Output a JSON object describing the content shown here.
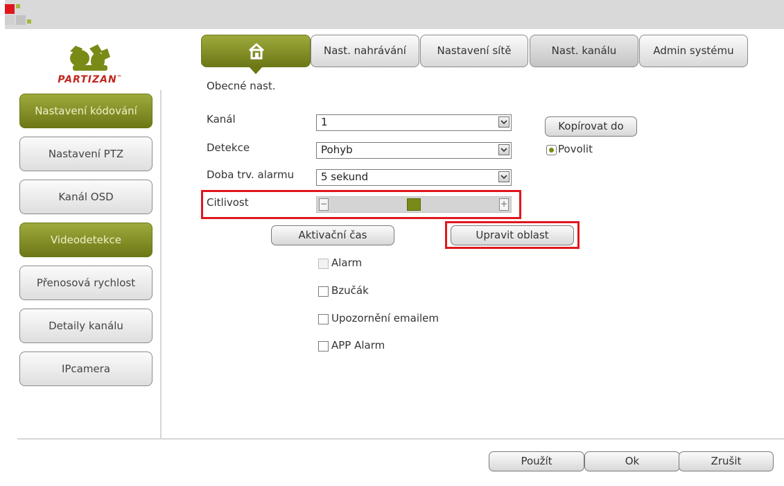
{
  "tabs": {
    "home_icon": "house-icon",
    "recording": "Nast. nahrávání",
    "network": "Nastavení sítě",
    "channel": "Nast. kanálu",
    "admin": "Admin systému"
  },
  "subtitle": "Obecné nast.",
  "logo": {
    "text": "PARTIZAN",
    "tm": "™"
  },
  "sidebar": {
    "items": [
      {
        "label": "Nastavení kódování",
        "active": true
      },
      {
        "label": "Nastavení PTZ",
        "active": false
      },
      {
        "label": "Kanál OSD",
        "active": false
      },
      {
        "label": "Videodetekce",
        "active": true
      },
      {
        "label": "Přenosová rychlost",
        "active": false
      },
      {
        "label": "Detaily kanálu",
        "active": false
      },
      {
        "label": "IPcamera",
        "active": false
      }
    ]
  },
  "form": {
    "channel_label": "Kanál",
    "channel_value": "1",
    "detection_label": "Detekce",
    "detection_value": "Pohyb",
    "alarm_duration_label": "Doba trv. alarmu",
    "alarm_duration_value": "5 sekund",
    "sensitivity_label": "Citlivost",
    "sensitivity_value": 0.5,
    "sensitivity_minus": "−",
    "sensitivity_plus": "+",
    "copy_button": "Kopírovat do",
    "enable_label": "Povolit",
    "enable_checked": true,
    "activation_time_button": "Aktivační čas",
    "edit_area_button": "Upravit oblast",
    "checkboxes": [
      {
        "label": "Alarm",
        "checked": false,
        "disabled": true
      },
      {
        "label": "Bzučák",
        "checked": false,
        "disabled": false
      },
      {
        "label": "Upozornění emailem",
        "checked": false,
        "disabled": false
      },
      {
        "label": "APP Alarm",
        "checked": false,
        "disabled": false
      }
    ]
  },
  "footer": {
    "apply": "Použít",
    "ok": "Ok",
    "cancel": "Zrušit"
  },
  "colors": {
    "accent": "#7a8a16",
    "highlight": "#e0161e",
    "brand": "#c0261e"
  }
}
